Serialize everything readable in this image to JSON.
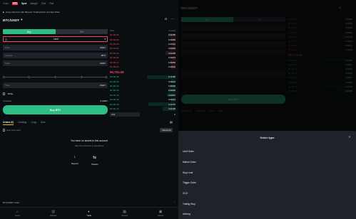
{
  "left": {
    "top_tabs": [
      "Conv",
      "Spot",
      "Margin",
      "Grid",
      "Fiat"
    ],
    "top_new_badge": "NEW",
    "banner": "Enjoy discount with Binance Trading Pairs and Eco Pass",
    "pair": "BTC/USDT",
    "buy_label": "Buy",
    "sell_label": "Sell",
    "order_type": "Limit",
    "price_label": "Price",
    "price_value": "USDT",
    "amount_label": "Amount",
    "amount_value": "BTC",
    "total_label": "Total",
    "total_value": "USDT",
    "tpsl_label": "TP/SL",
    "avail_label": "Available",
    "avail_value": "0 USDT",
    "buy_button": "Buy BTC",
    "orderbook": {
      "price_header": "Price",
      "amount_header": "Amount",
      "asks": [
        {
          "price": "96,782.95",
          "amount": "0.03458"
        },
        {
          "price": "96,782.80",
          "amount": "0.00060"
        },
        {
          "price": "96,782.69",
          "amount": "0.00012"
        },
        {
          "price": "96,782.60",
          "amount": "0.00050"
        },
        {
          "price": "96,782.50",
          "amount": "0.01068"
        },
        {
          "price": "96,782.34",
          "amount": "0.00074"
        },
        {
          "price": "96,782.17",
          "amount": "0.00062"
        },
        {
          "price": "96,782.00",
          "amount": "0.00042"
        }
      ],
      "mid": "96,781.99",
      "bids": [
        {
          "price": "96,781.99",
          "amount": "0.12156"
        },
        {
          "price": "96,781.80",
          "amount": "0.00012"
        },
        {
          "price": "96,781.69",
          "amount": "0.00060"
        },
        {
          "price": "96,781.50",
          "amount": "0.00056"
        },
        {
          "price": "96,781.40",
          "amount": "0.00067"
        },
        {
          "price": "96,781.30",
          "amount": "0.00014"
        },
        {
          "price": "96,781.20",
          "amount": "0.11767"
        },
        {
          "price": "96,781.10",
          "amount": "0.04238"
        }
      ],
      "depth_select": "0.01"
    },
    "orders_tabs": [
      "Orders (0)",
      "Holdings",
      "Copy",
      "Bots"
    ],
    "hide_other": "Hide other pairs",
    "cancel_all": "Cancel All",
    "no_orders_title": "You have no assets in this account",
    "no_orders_sub": "Deposit or transfer to get started",
    "action_deposit": "Deposit",
    "action_transfer": "Transfer",
    "chart_label": "BTC/USDT Chart",
    "nav": [
      "Home",
      "Markets",
      "Trade",
      "Futures",
      "Assets"
    ]
  },
  "right": {
    "pair": "BTC/USDT",
    "buy_label": "Buy",
    "sell_label": "Sell",
    "button": "Buy BTC",
    "tabs": [
      "Orders (0)",
      "Holdings",
      "Copy",
      "Bots"
    ]
  },
  "sheet": {
    "title": "Order type",
    "items": [
      "Limit Order",
      "Market Order",
      "Stop Limit",
      "Trigger Order",
      "OCO",
      "Trailing Stop",
      "Iceberg"
    ]
  },
  "colors": {
    "buy": "#2ebd85",
    "sell": "#f6465d",
    "accent": "#f0b90b",
    "background": "#0b0e11"
  }
}
